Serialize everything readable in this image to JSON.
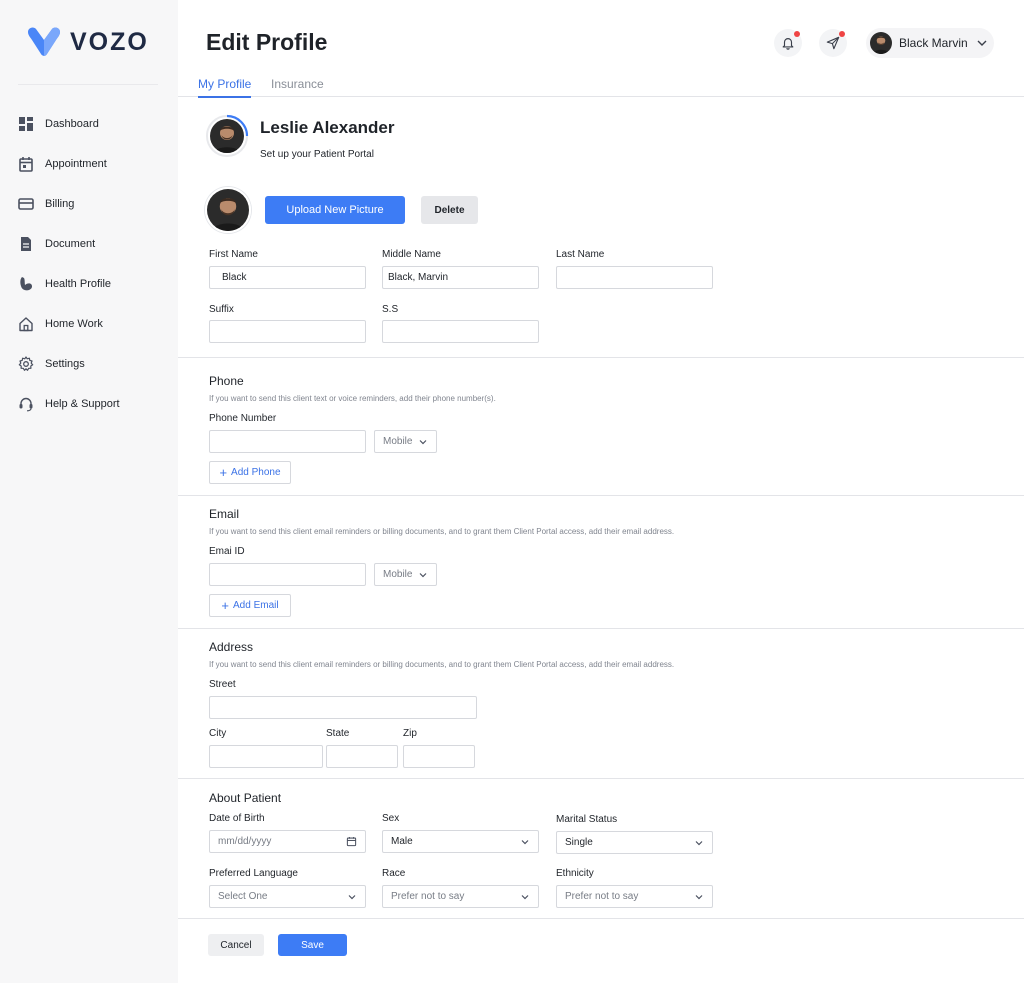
{
  "brand": {
    "name": "VOZO",
    "accent": "#3d7cf5"
  },
  "sidebar": {
    "items": [
      {
        "label": "Dashboard",
        "icon": "dashboard-icon"
      },
      {
        "label": "Appointment",
        "icon": "calendar-icon"
      },
      {
        "label": "Billing",
        "icon": "credit-card-icon"
      },
      {
        "label": "Document",
        "icon": "document-icon"
      },
      {
        "label": "Health Profile",
        "icon": "muscle-icon"
      },
      {
        "label": "Home Work",
        "icon": "home-icon"
      },
      {
        "label": "Settings",
        "icon": "gear-icon"
      },
      {
        "label": "Help & Support",
        "icon": "headset-icon"
      }
    ]
  },
  "header": {
    "title": "Edit Profile",
    "user_name": "Black Marvin"
  },
  "tabs": [
    {
      "label": "My Profile",
      "active": true
    },
    {
      "label": "Insurance",
      "active": false
    }
  ],
  "profile": {
    "name": "Leslie Alexander",
    "subtitle": "Set up your Patient Portal",
    "upload_label": "Upload New Picture",
    "delete_label": "Delete"
  },
  "name_fields": {
    "first_name": {
      "label": "First Name",
      "value": "Black"
    },
    "middle_name": {
      "label": "Middle Name",
      "value": "Black, Marvin"
    },
    "last_name": {
      "label": "Last Name",
      "value": ""
    },
    "suffix": {
      "label": "Suffix",
      "value": ""
    },
    "ss": {
      "label": "S.S",
      "value": ""
    }
  },
  "phone": {
    "title": "Phone",
    "hint": "If you want to send this client text or voice reminders, add their phone number(s).",
    "field_label": "Phone Number",
    "type_value": "Mobile",
    "add_label": "Add Phone"
  },
  "email": {
    "title": "Email",
    "hint": "If you want to send this client email reminders or billing documents, and to grant them Client Portal access, add their email address.",
    "field_label": "Emai ID",
    "type_value": "Mobile",
    "add_label": "Add Email"
  },
  "address": {
    "title": "Address",
    "hint": "If you want to send this client email reminders or billing documents, and to grant them Client Portal access, add their email address.",
    "street_label": "Street",
    "city_label": "City",
    "state_label": "State",
    "zip_label": "Zip"
  },
  "about": {
    "title": "About Patient",
    "dob_label": "Date of Birth",
    "dob_placeholder": "mm/dd/yyyy",
    "sex_label": "Sex",
    "sex_value": "Male",
    "marital_label": "Marital Status",
    "marital_value": "Single",
    "language_label": "Preferred Language",
    "language_value": "Select One",
    "race_label": "Race",
    "race_value": "Prefer not to say",
    "ethnicity_label": "Ethnicity",
    "ethnicity_value": "Prefer not to say"
  },
  "footer": {
    "cancel_label": "Cancel",
    "save_label": "Save"
  }
}
